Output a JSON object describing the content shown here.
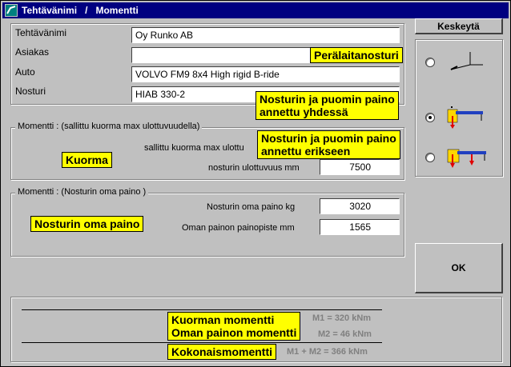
{
  "window": {
    "title": "Tehtävänimi   /   Momentti"
  },
  "form": {
    "tehtavanimi_label": "Tehtävänimi",
    "tehtavanimi_value": "Oy Runko AB",
    "asiakas_label": "Asiakas",
    "asiakas_value": "",
    "auto_label": "Auto",
    "auto_value": "VOLVO FM9 8x4 High rigid B-ride",
    "nosturi_label": "Nosturi",
    "nosturi_value": "HIAB  330-2"
  },
  "group1": {
    "title": "Momentti : (sallittu kuorma max ulottuvuudella)",
    "kuorma_label": "sallittu kuorma max ulottu",
    "ulottuvuus_label": "nosturin ulottuvuus mm",
    "ulottuvuus_value": "7500",
    "kuorma_callout": "Kuorma"
  },
  "group2": {
    "title": "Momentti : (Nosturin oma paino )",
    "oma_paino_label": "Nosturin oma paino  kg",
    "oma_paino_value": "3020",
    "painopiste_label": "Oman painon painopiste  mm",
    "painopiste_value": "1565",
    "callout": "Nosturin oma paino"
  },
  "buttons": {
    "keskeyta": "Keskeytä",
    "ok": "OK"
  },
  "options": {
    "peralaitanosturi": "Perälaitanosturi",
    "yhdessa_line1": "Nosturin ja puomin paino",
    "yhdessa_line2": "annettu yhdessä",
    "erikseen_line1": "Nosturin ja puomin paino",
    "erikseen_line2": "annettu erikseen",
    "selected": "yhdessa"
  },
  "results": {
    "kuorman_momentti_label": "Kuorman momentti",
    "oman_painon_momentti_label": "Oman painon momentti",
    "kokonaismomentti_label": "Kokonaismomentti",
    "m1": "M1 = 320 kNm",
    "m2": "M2 = 46 kNm",
    "total": "M1 + M2 = 366 kNm"
  },
  "colors": {
    "titlebar": "#000080",
    "callout": "#ffff00",
    "result_gray": "#808080"
  }
}
